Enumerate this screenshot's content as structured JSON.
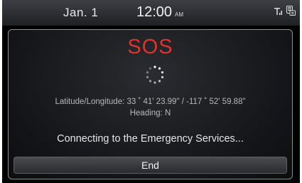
{
  "status_bar": {
    "date": "Jan.  1",
    "time": "12:00",
    "ampm": "AM",
    "icons": [
      "signal-icon",
      "phone-contacts-icon"
    ]
  },
  "dialog": {
    "title": "SOS",
    "title_color": "#e0332d",
    "spinner_icon": "loading-spinner-icon",
    "coordinates": "Latitude/Longitude: 33 ˚ 41' 23.99\" / -117 ˚ 52' 59.88\"",
    "heading": "Heading: N",
    "message": "Connecting to the Emergency Services...",
    "end_label": "End"
  }
}
